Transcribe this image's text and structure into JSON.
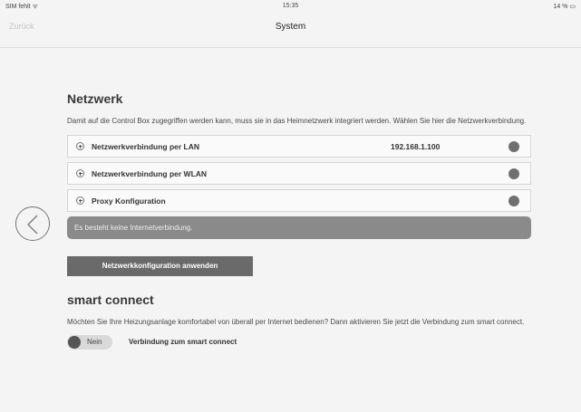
{
  "status_bar": {
    "carrier": "SIM fehlt ᯤ",
    "time": "15:35",
    "battery": "14 % ▭"
  },
  "nav": {
    "back_label": "Zurück",
    "title": "System"
  },
  "netzwerk": {
    "title": "Netzwerk",
    "description": "Damit auf die Control Box zugegriffen werden kann, muss sie in das Heimnetzwerk integriert werden. Wählen Sie hier die Netzwerkverbindung.",
    "rows": [
      {
        "label": "Netzwerkverbindung per LAN",
        "value": "192.168.1.100"
      },
      {
        "label": "Netzwerkverbindung per WLAN",
        "value": ""
      },
      {
        "label": "Proxy Konfiguration",
        "value": ""
      }
    ],
    "alert": "Es besteht keine Internetverbindung.",
    "apply_label": "Netzwerkkonfiguration anwenden"
  },
  "smart_connect": {
    "title": "smart connect",
    "description": "Möchten Sie Ihre Heizungsanlage komfortabel von überall per Internet bedienen? Dann aktivieren Sie jetzt die Verbindung zum smart connect.",
    "toggle_value": "Nein",
    "toggle_label": "Verbindung zum smart connect"
  },
  "icons": {
    "back_arrow": "chevron-left-icon",
    "expand": "plus-circle-icon",
    "status": "status-dot-icon"
  },
  "colors": {
    "status_dot": "#6f6f6f",
    "alert_bg": "#8a8a8a",
    "button_bg": "#6a6a6a"
  }
}
